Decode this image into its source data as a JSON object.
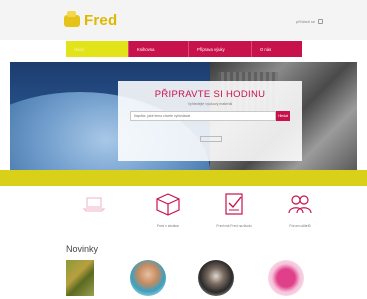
{
  "header": {
    "logo_text": "Fred",
    "top_links": "přihlásit se"
  },
  "nav": {
    "items": [
      {
        "label": "Úvod",
        "active": true
      },
      {
        "label": "Knihovna",
        "active": false
      },
      {
        "label": "Příprava výuky",
        "active": false
      },
      {
        "label": "O nás",
        "active": false
      }
    ]
  },
  "hero": {
    "title": "PŘIPRAVTE SI HODINU",
    "subtitle": "Vyhledejte výukový materiál",
    "search_placeholder": "Napište, jaké téma chcete vyhledávat",
    "search_button": "Hledat",
    "note": "",
    "link": ""
  },
  "strip": {
    "text": ""
  },
  "features": [
    {
      "label": "",
      "icon": "laptop-icon"
    },
    {
      "label": "Fred v zkratce",
      "icon": "cube-icon"
    },
    {
      "label": "Fred má Fred na školu",
      "icon": "checklist-icon"
    },
    {
      "label": "Fórum učitelů",
      "icon": "users-icon"
    }
  ],
  "news": {
    "title": "Novinky"
  },
  "colors": {
    "accent": "#c8124b",
    "yellow": "#d9d01a",
    "logo": "#e0b800"
  }
}
